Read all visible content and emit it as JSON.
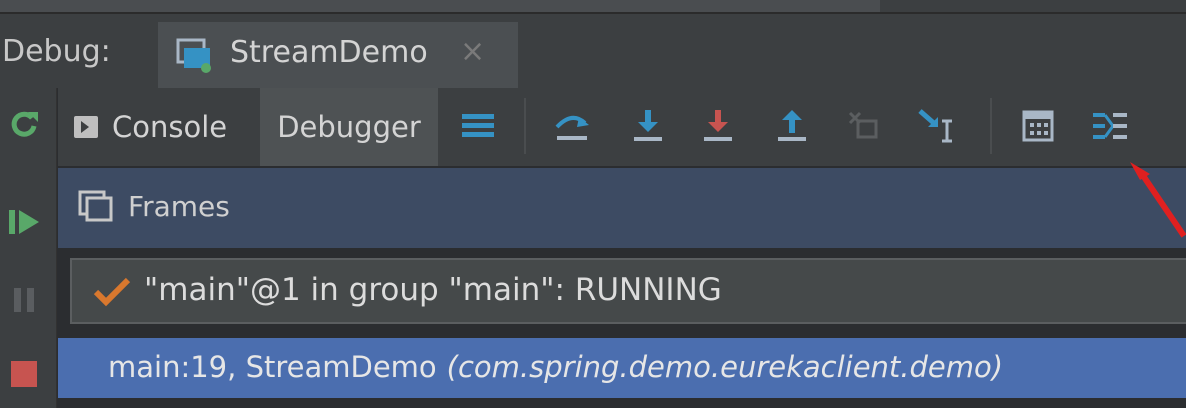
{
  "debug_panel": {
    "label": "Debug:",
    "tab": {
      "title": "StreamDemo",
      "close": "×"
    }
  },
  "toolbar": {
    "console_label": "Console",
    "debugger_label": "Debugger",
    "icons": [
      "frames-menu-icon",
      "step-over-icon",
      "step-into-icon",
      "force-step-into-icon",
      "step-out-icon",
      "drop-frame-icon",
      "run-to-cursor-icon",
      "evaluate-expression-icon",
      "trace-current-stream-chain-icon"
    ]
  },
  "side_actions": [
    "rerun-icon",
    "resume-icon",
    "pause-icon",
    "stop-icon"
  ],
  "frames": {
    "title": "Frames",
    "thread": "\"main\"@1 in group \"main\": RUNNING",
    "selected_frame": {
      "location": "main:19, StreamDemo",
      "package": "(com.spring.demo.eurekaclient.demo)"
    }
  },
  "colors": {
    "accent_blue": "#3592c4",
    "stop_red": "#c75450",
    "resume_green": "#59a869",
    "selection": "#4b6eaf",
    "header": "#3d4b63"
  }
}
